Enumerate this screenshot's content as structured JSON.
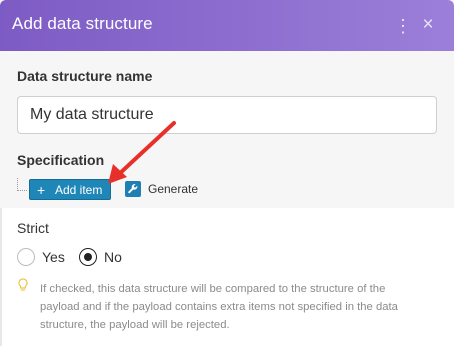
{
  "dialog": {
    "title": "Add data structure",
    "menu_icon": "more-vertical-icon",
    "close_icon": "close-icon",
    "header_color": "#8b6bcf"
  },
  "name_field": {
    "label": "Data structure name",
    "value": "My data structure"
  },
  "specification": {
    "label": "Specification",
    "add_item_label": "Add item",
    "add_item_icon": "plus-icon",
    "generate_label": "Generate",
    "generate_icon": "wrench-icon",
    "button_color": "#1f86b8"
  },
  "strict": {
    "label": "Strict",
    "options": [
      {
        "label": "Yes",
        "selected": false
      },
      {
        "label": "No",
        "selected": true
      }
    ],
    "help_icon": "lightbulb-icon",
    "help_text": "If checked, this data structure will be compared to the structure of the payload and if the payload contains extra items not specified in the data structure, the payload will be rejected."
  },
  "annotation": {
    "arrow_color": "#e8302a"
  }
}
